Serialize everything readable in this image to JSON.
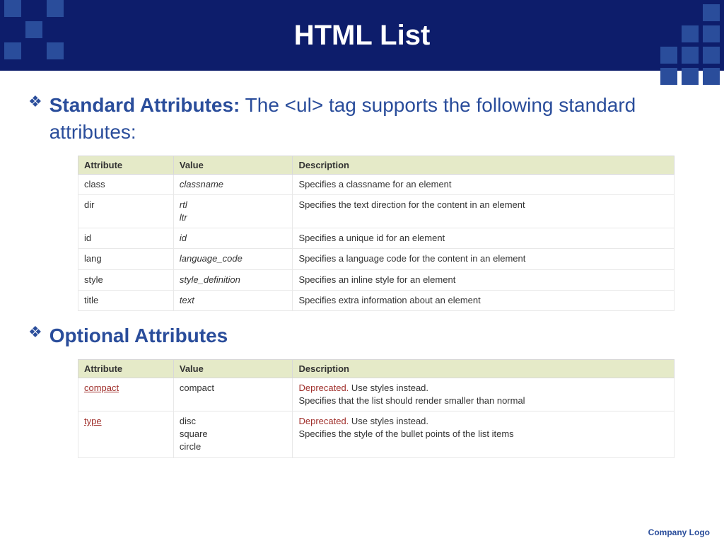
{
  "header": {
    "title": "HTML List"
  },
  "section1": {
    "label": "Standard Attributes:",
    "text": " The <ul> tag supports the following standard attributes:"
  },
  "table1": {
    "headers": {
      "attr": "Attribute",
      "value": "Value",
      "desc": "Description"
    },
    "rows": [
      {
        "attr": "class",
        "value": "classname",
        "desc": "Specifies a classname for an element"
      },
      {
        "attr": "dir",
        "value": "rtl\nltr",
        "desc": "Specifies the text direction for the content in an element"
      },
      {
        "attr": "id",
        "value": "id",
        "desc": "Specifies a unique id for an element"
      },
      {
        "attr": "lang",
        "value": "language_code",
        "desc": "Specifies a language code for the content in an element"
      },
      {
        "attr": "style",
        "value": "style_definition",
        "desc": "Specifies an inline style for an element"
      },
      {
        "attr": "title",
        "value": "text",
        "desc": "Specifies extra information about an element"
      }
    ]
  },
  "section2": {
    "label": "Optional Attributes"
  },
  "table2": {
    "headers": {
      "attr": "Attribute",
      "value": "Value",
      "desc": "Description"
    },
    "rows": [
      {
        "attr": "compact",
        "value": "compact",
        "dep": "Deprecated.",
        "desc": " Use styles instead.\nSpecifies that the list should render smaller than normal"
      },
      {
        "attr": "type",
        "value": "disc\nsquare\ncircle",
        "dep": "Deprecated.",
        "desc": " Use styles instead.\nSpecifies the style of the bullet points of the list items"
      }
    ]
  },
  "footer": {
    "text": "Company  Logo"
  }
}
